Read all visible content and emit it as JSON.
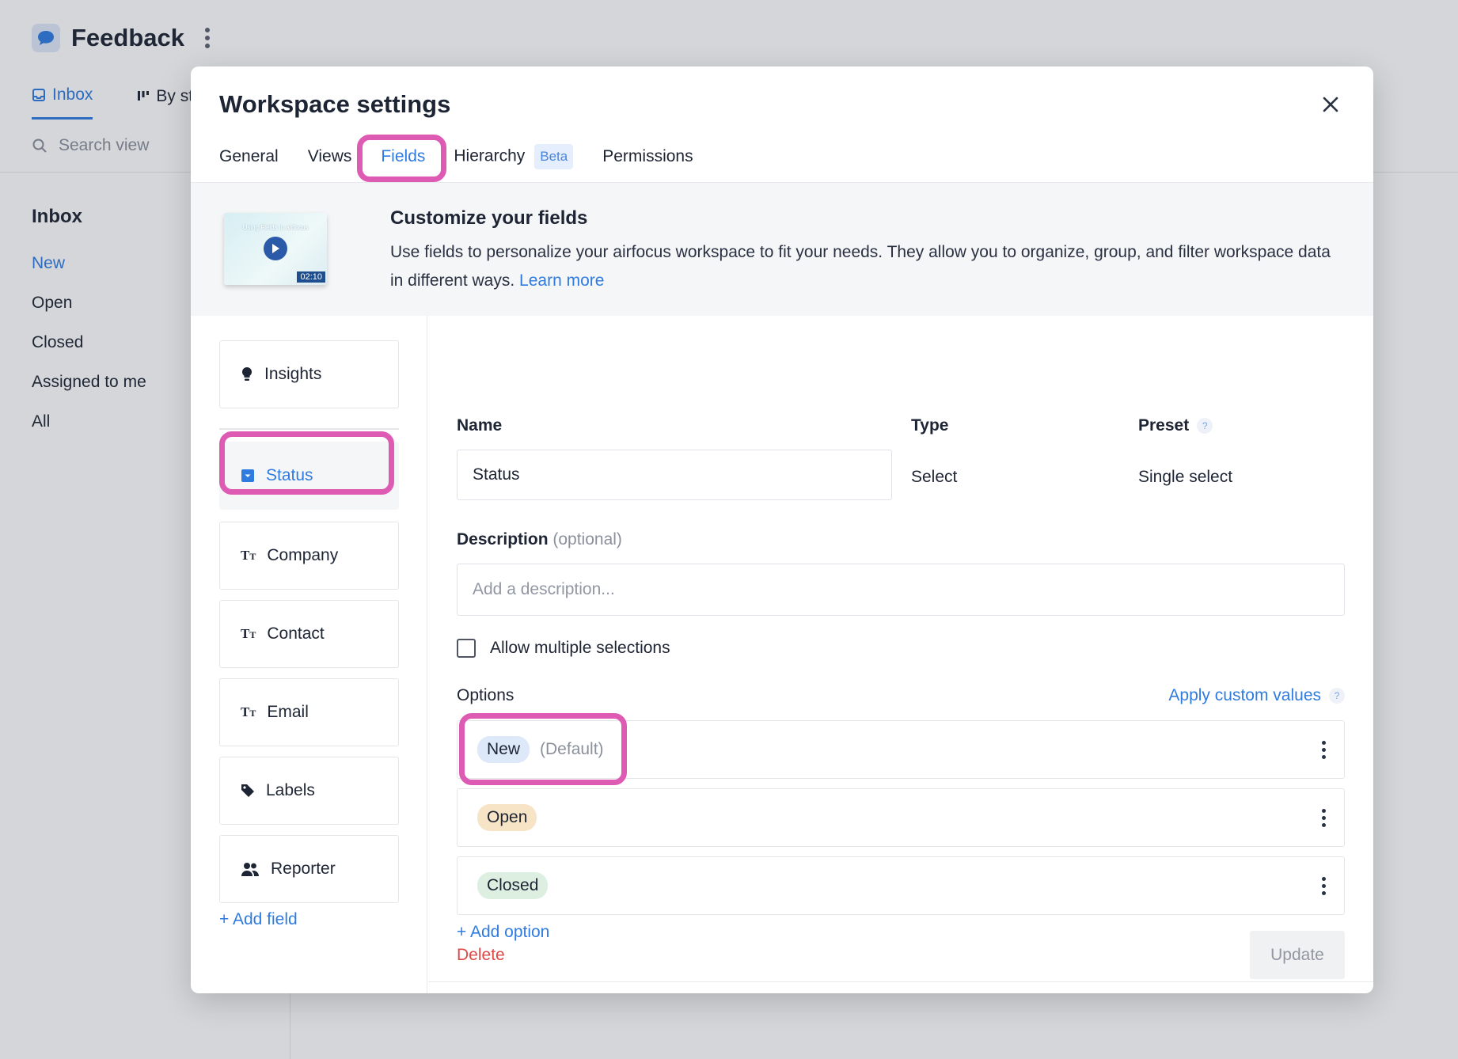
{
  "app": {
    "title": "Feedback",
    "tabs": [
      {
        "label": "Inbox",
        "active": true
      },
      {
        "label": "By st"
      }
    ],
    "search_placeholder": "Search view",
    "sidebar": {
      "heading": "Inbox",
      "items": [
        {
          "label": "New",
          "active": true
        },
        {
          "label": "Open"
        },
        {
          "label": "Closed"
        },
        {
          "label": "Assigned to me"
        },
        {
          "label": "All"
        }
      ]
    }
  },
  "modal": {
    "title": "Workspace settings",
    "tabs": [
      {
        "label": "General"
      },
      {
        "label": "Views"
      },
      {
        "label": "Fields",
        "active": true
      },
      {
        "label": "Hierarchy",
        "badge": "Beta"
      },
      {
        "label": "Permissions"
      }
    ],
    "intro": {
      "video_title": "Using Fields in airfocus",
      "video_duration": "02:10",
      "heading": "Customize your fields",
      "text": "Use fields to personalize your airfocus workspace to fit your needs. They allow you to organize, group, and filter workspace data in different ways.",
      "link": "Learn more"
    },
    "fields": [
      {
        "label": "Insights",
        "icon": "lightbulb-icon"
      },
      {
        "label": "Status",
        "icon": "select-icon",
        "active": true
      },
      {
        "label": "Company",
        "icon": "text-icon"
      },
      {
        "label": "Contact",
        "icon": "text-icon"
      },
      {
        "label": "Email",
        "icon": "text-icon"
      },
      {
        "label": "Labels",
        "icon": "tag-icon"
      },
      {
        "label": "Reporter",
        "icon": "users-icon"
      }
    ],
    "add_field": "+ Add field",
    "editor": {
      "name_label": "Name",
      "name_value": "Status",
      "type_label": "Type",
      "type_value": "Select",
      "preset_label": "Preset",
      "preset_value": "Single select",
      "description_label": "Description",
      "description_optional": "(optional)",
      "description_placeholder": "Add a description...",
      "allow_multiple_label": "Allow multiple selections",
      "options_label": "Options",
      "apply_custom": "Apply custom values",
      "options": [
        {
          "label": "New",
          "note": "(Default)",
          "color": "#dde8f8"
        },
        {
          "label": "Open",
          "color": "#f7e4c6"
        },
        {
          "label": "Closed",
          "color": "#dcefe0"
        }
      ],
      "add_option": "+ Add option",
      "delete_label": "Delete",
      "update_label": "Update"
    }
  },
  "colors": {
    "accent": "#2f7be0",
    "highlight": "#dd5bb3",
    "danger": "#e04848"
  }
}
